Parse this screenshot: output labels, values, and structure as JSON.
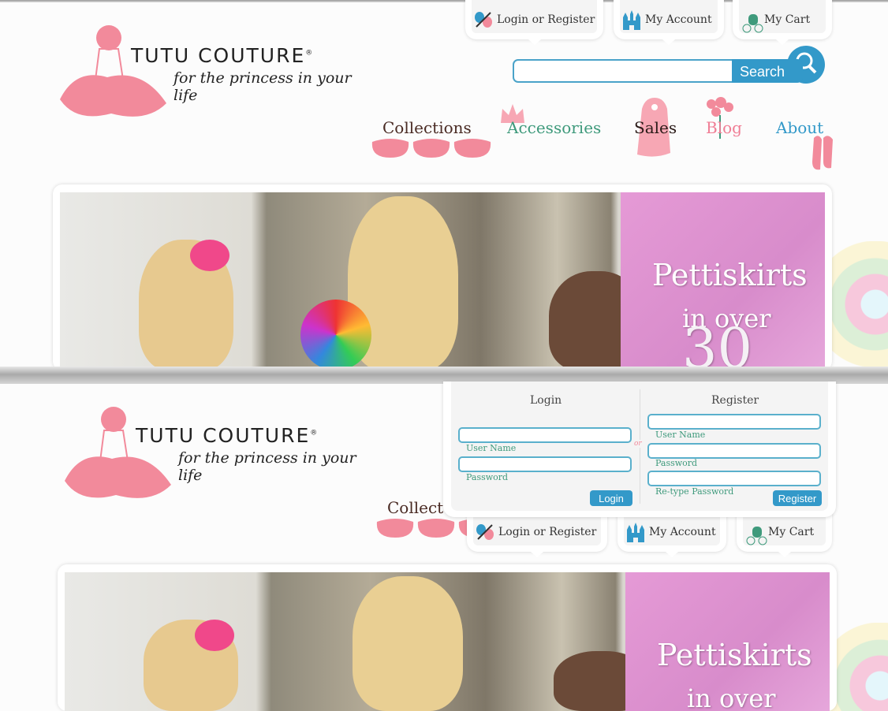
{
  "brand": {
    "name": "TUTU COUTURE",
    "registered": "®",
    "tagline": "for the princess in your life"
  },
  "top_tabs": [
    {
      "label": "Login or Register",
      "icon": "butterfly-icon"
    },
    {
      "label": "My Account",
      "icon": "castle-icon"
    },
    {
      "label": "My Cart",
      "icon": "carriage-icon"
    }
  ],
  "search": {
    "placeholder": "",
    "value": "",
    "button": "Search"
  },
  "nav": [
    {
      "label": "Collections",
      "color": "#4a2b24"
    },
    {
      "label": "Accessories",
      "color": "#3f9a7c"
    },
    {
      "label": "Sales",
      "color": "#2a1a17"
    },
    {
      "label": "Blog",
      "color": "#f07e95"
    },
    {
      "label": "About",
      "color": "#3399c9"
    }
  ],
  "nav_partial": "Collect",
  "banner": {
    "line1": "Pettiskirts",
    "line2": "in over",
    "line3": "30"
  },
  "login_panel": {
    "login": {
      "heading": "Login",
      "username_label": "User Name",
      "password_label": "Password",
      "button": "Login"
    },
    "or": "or",
    "register": {
      "heading": "Register",
      "username_label": "User Name",
      "password_label": "Password",
      "retype_label": "Re-type Password",
      "button": "Register"
    }
  },
  "colors": {
    "accent": "#3399c9",
    "pink": "#f28a9b",
    "green": "#3f9a7c"
  }
}
